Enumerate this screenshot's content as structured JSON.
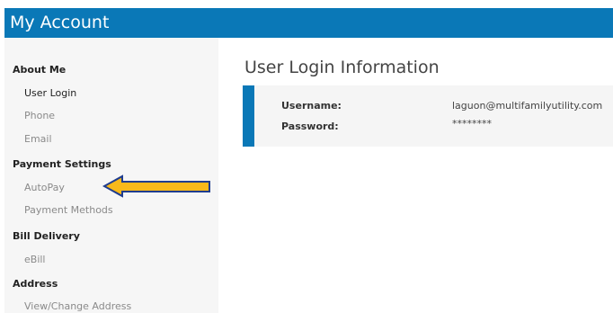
{
  "header": {
    "title": "My Account"
  },
  "sidebar": {
    "about_me": {
      "label": "About Me",
      "items": [
        {
          "label": "User Login"
        },
        {
          "label": "Phone"
        },
        {
          "label": "Email"
        }
      ]
    },
    "payment_settings": {
      "label": "Payment Settings",
      "items": [
        {
          "label": "AutoPay"
        },
        {
          "label": "Payment Methods"
        }
      ]
    },
    "bill_delivery": {
      "label": "Bill Delivery",
      "items": [
        {
          "label": "eBill"
        }
      ]
    },
    "address": {
      "label": "Address",
      "items": [
        {
          "label": "View/Change Address"
        }
      ]
    }
  },
  "main": {
    "title": "User Login Information",
    "fields": {
      "username": {
        "label": "Username:",
        "value": "laguon@multifamilyutility.com"
      },
      "password": {
        "label": "Password:",
        "value": "********"
      }
    }
  },
  "colors": {
    "brand": "#0a78b7",
    "arrow_fill": "#f9b91a",
    "arrow_stroke": "#1f3d8f"
  },
  "icons": {
    "pointer": "left-arrow-icon"
  }
}
